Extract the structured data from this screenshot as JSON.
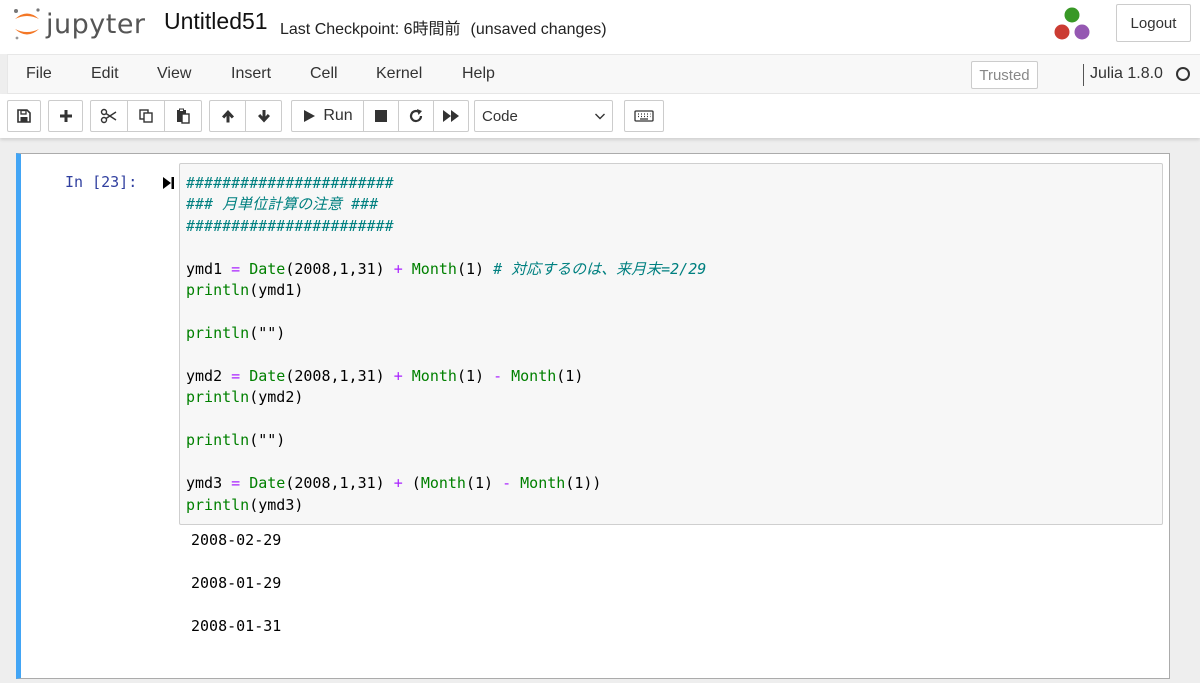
{
  "header": {
    "logo_text": "jupyter",
    "notebook_name": "Untitled51",
    "checkpoint_text": "Last Checkpoint: 6時間前",
    "unsaved_text": "(unsaved changes)",
    "logout_label": "Logout"
  },
  "menubar": {
    "items": [
      {
        "label": "File"
      },
      {
        "label": "Edit"
      },
      {
        "label": "View"
      },
      {
        "label": "Insert"
      },
      {
        "label": "Cell"
      },
      {
        "label": "Kernel"
      },
      {
        "label": "Help"
      }
    ],
    "trusted_label": "Trusted",
    "kernel_name": "Julia 1.8.0"
  },
  "toolbar": {
    "run_label": "Run",
    "cell_type": "Code",
    "icons": [
      "save-icon",
      "plus-icon",
      "cut-icon",
      "copy-icon",
      "paste-icon",
      "arrow-up-icon",
      "arrow-down-icon",
      "play-icon",
      "stop-icon",
      "restart-icon",
      "fast-forward-icon",
      "keyboard-icon"
    ]
  },
  "cell": {
    "prompt": "In [23]:",
    "code": {
      "l1": "#######################",
      "l2": "### 月単位計算の注意 ###",
      "l3": "#######################",
      "ymd1_var": "ymd1 ",
      "ymd1_date": "Date",
      "ymd1_args": "(2008,1,31) ",
      "ymd1_month": "Month",
      "ymd1_marg": "(1) ",
      "ymd1_comment": "# 対応するのは、来月末=2/29",
      "println": "println",
      "pr_ymd1": "(ymd1)",
      "pr_empty": "(\"\")",
      "ymd2_var": "ymd2 ",
      "ymd2_args": "(2008,1,31) ",
      "ymd2_marg1": "(1) ",
      "ymd2_marg2": "(1)",
      "pr_ymd2": "(ymd2)",
      "ymd3_var": "ymd3 ",
      "ymd3_args": "(2008,1,31) ",
      "ymd3_open": "(",
      "ymd3_marg1": "(1) ",
      "ymd3_marg2": "(1))",
      "pr_ymd3": "(ymd3)",
      "op_eq": "= ",
      "op_plus": "+ ",
      "op_minus": "- "
    },
    "outputs": [
      "2008-02-29",
      "2008-01-29",
      "2008-01-31"
    ]
  },
  "colors": {
    "accent": "#42a5f5",
    "prompt": "#303f9f",
    "comment": "#008080",
    "builtin": "#008000",
    "operator": "#aa22ff",
    "logo_orange": "#f37726"
  }
}
